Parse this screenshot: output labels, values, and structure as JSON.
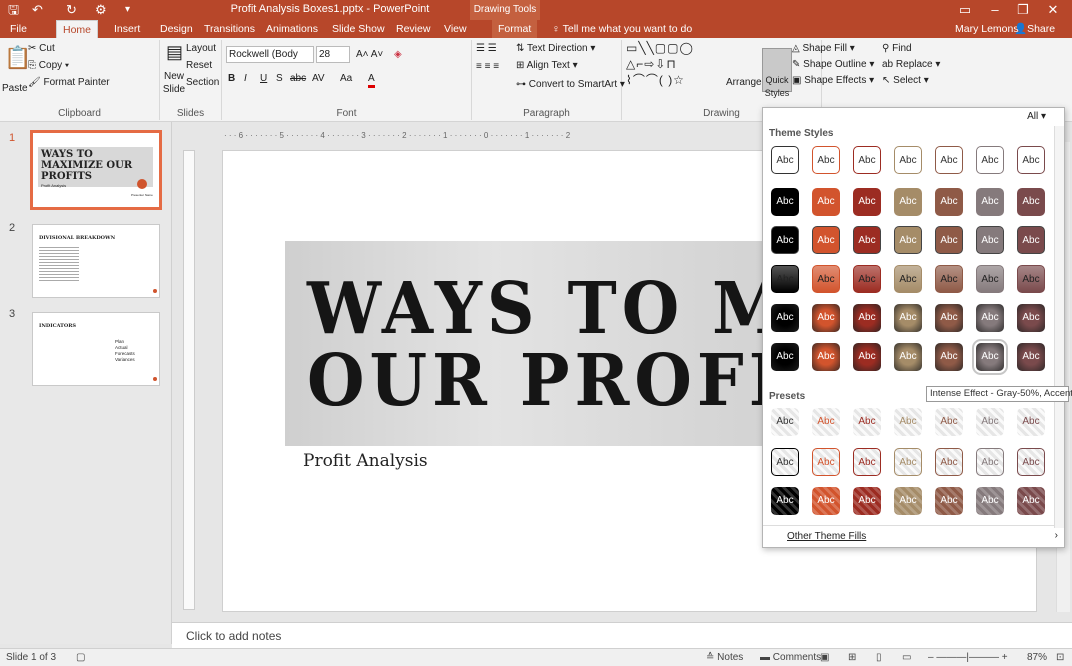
{
  "window": {
    "title": "Profit Analysis Boxes1.pptx - PowerPoint",
    "context_tab_group": "Drawing Tools",
    "user": "Mary Lemons",
    "share": "Share"
  },
  "tabs": [
    "File",
    "Home",
    "Insert",
    "Design",
    "Transitions",
    "Animations",
    "Slide Show",
    "Review",
    "View",
    "Format"
  ],
  "tell_me": "Tell me what you want to do",
  "ribbon": {
    "clipboard": {
      "label": "Clipboard",
      "paste": "Paste",
      "cut": "Cut",
      "copy": "Copy",
      "format_painter": "Format Painter"
    },
    "slides": {
      "label": "Slides",
      "new_slide": "New Slide",
      "layout": "Layout",
      "reset": "Reset",
      "section": "Section"
    },
    "font": {
      "label": "Font",
      "family": "Rockwell (Body",
      "size": "28",
      "bold": "B",
      "italic": "I",
      "underline": "U",
      "shadow": "S",
      "strike": "abc",
      "spacing": "AV",
      "case": "Aa",
      "color": "A"
    },
    "paragraph": {
      "label": "Paragraph",
      "text_direction": "Text Direction",
      "align_text": "Align Text",
      "convert_smartart": "Convert to SmartArt"
    },
    "drawing": {
      "label": "Drawing",
      "arrange": "Arrange",
      "quick_styles": "Quick Styles",
      "shape_fill": "Shape Fill",
      "shape_outline": "Shape Outline",
      "shape_effects": "Shape Effects"
    },
    "editing": {
      "find": "Find",
      "replace": "Replace",
      "select": "Select"
    }
  },
  "slides": [
    {
      "num": "1",
      "title": "WAYS TO MAXIMIZE OUR PROFITS",
      "sub": "Profit Analysis",
      "footer": "Presenter Name"
    },
    {
      "num": "2",
      "title": "DIVISIONAL BREAKDOWN"
    },
    {
      "num": "3",
      "title": "INDICATORS",
      "bullets": [
        "Plan",
        "Actual",
        "Forecasts",
        "Variances"
      ]
    }
  ],
  "slide": {
    "line1": "WAYS TO MAXIMIZE",
    "line2": "OUR PROFITS",
    "subtitle": "Profit Analysis"
  },
  "notes_placeholder": "Click to add notes",
  "gallery": {
    "filter": "All",
    "section1": "Theme Styles",
    "section2": "Presets",
    "swatch_text": "Abc",
    "tooltip": "Intense Effect - Gray-50%, Accent 5",
    "footer": "Other Theme Fills",
    "colors": [
      "#000000",
      "#d2542d",
      "#9c2c22",
      "#a58c68",
      "#8f5a47",
      "#857a7c",
      "#7a4a4c"
    ]
  },
  "status": {
    "slide_of": "Slide 1 of 3",
    "notes": "Notes",
    "comments": "Comments",
    "zoom": "87%"
  }
}
